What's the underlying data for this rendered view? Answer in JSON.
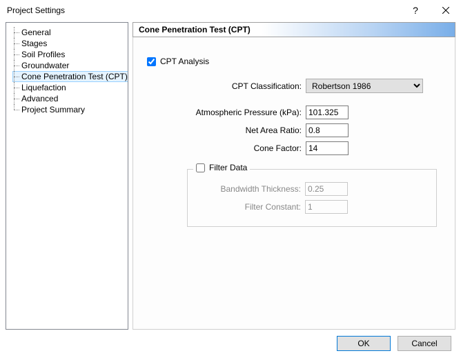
{
  "window": {
    "title": "Project Settings",
    "help": "?",
    "close": "×"
  },
  "tree": {
    "items": [
      "General",
      "Stages",
      "Soil Profiles",
      "Groundwater",
      "Cone Penetration Test (CPT)",
      "Liquefaction",
      "Advanced",
      "Project Summary"
    ],
    "selected_index": 4
  },
  "header": {
    "title": "Cone Penetration Test (CPT)"
  },
  "form": {
    "cpt_checkbox_label": "CPT Analysis",
    "cpt_checked": true,
    "classification_label": "CPT Classification:",
    "classification_value": "Robertson 1986",
    "pressure_label": "Atmospheric Pressure (kPa):",
    "pressure_value": "101.325",
    "ratio_label": "Net Area Ratio:",
    "ratio_value": "0.8",
    "cone_label": "Cone Factor:",
    "cone_value": "14",
    "filter_legend": "Filter Data",
    "filter_checked": false,
    "bandwidth_label": "Bandwidth Thickness:",
    "bandwidth_value": "0.25",
    "constant_label": "Filter Constant:",
    "constant_value": "1"
  },
  "footer": {
    "ok": "OK",
    "cancel": "Cancel"
  }
}
